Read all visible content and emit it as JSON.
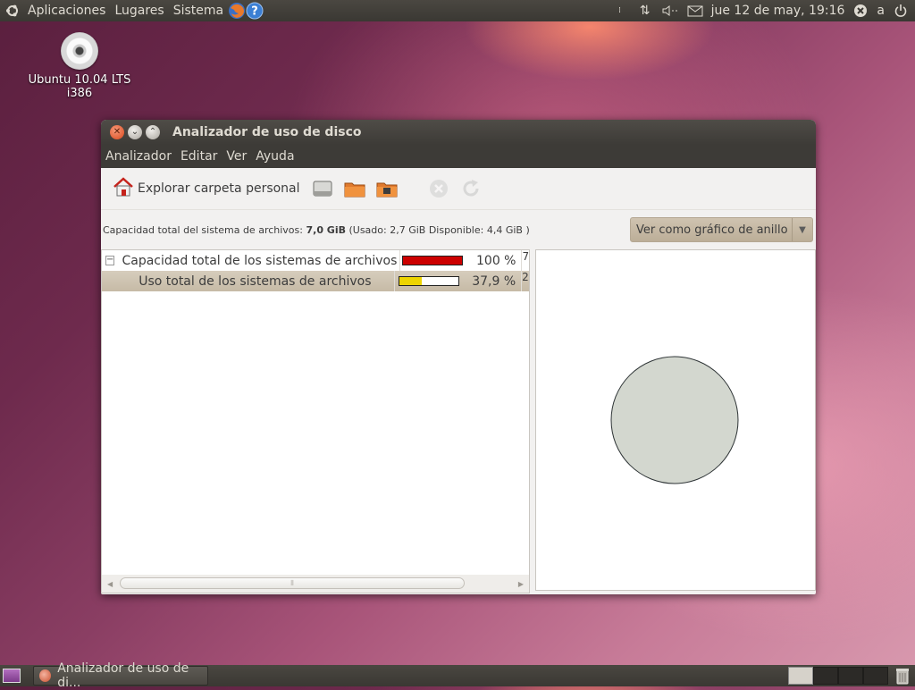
{
  "top_panel": {
    "menus": [
      "Aplicaciones",
      "Lugares",
      "Sistema"
    ],
    "datetime": "jue 12 de may, 19:16",
    "user_short": "a",
    "icons": [
      "ubuntu-logo-icon",
      "firefox-icon",
      "help-icon",
      "network-icon",
      "volume-icon",
      "mail-icon",
      "chat-status-icon",
      "power-icon"
    ]
  },
  "desktop": {
    "icon_label_line1": "Ubuntu 10.04 LTS",
    "icon_label_line2": "i386"
  },
  "window": {
    "title": "Analizador de uso de disco",
    "menu": [
      "Analizador",
      "Editar",
      "Ver",
      "Ayuda"
    ],
    "toolbar": {
      "home_label": "Explorar carpeta personal",
      "icons": [
        "home-icon",
        "scan-filesystem-icon",
        "scan-folder-icon",
        "scan-remote-icon",
        "stop-icon",
        "refresh-icon"
      ]
    },
    "info": {
      "prefix": "Capacidad total del sistema de archivos:",
      "total": "7,0 GiB",
      "detail": "(Usado: 2,7 GiB Disponible: 4,4 GiB )"
    },
    "view_combo": "Ver como gráfico de anillo",
    "rows": [
      {
        "expander": "−",
        "name": "Capacidad total de los sistemas de archivos",
        "percent": "100 %",
        "usage": 1.0,
        "color": "#cc0000",
        "more": "7"
      },
      {
        "expander": "",
        "name": "Uso total de los sistemas de archivos",
        "percent": "37,9 %",
        "usage": 0.379,
        "color": "#edd400",
        "more": "2"
      }
    ],
    "ring_color": "#d3d7cf"
  },
  "bottom_panel": {
    "task_label": "Analizador de uso de di..."
  }
}
